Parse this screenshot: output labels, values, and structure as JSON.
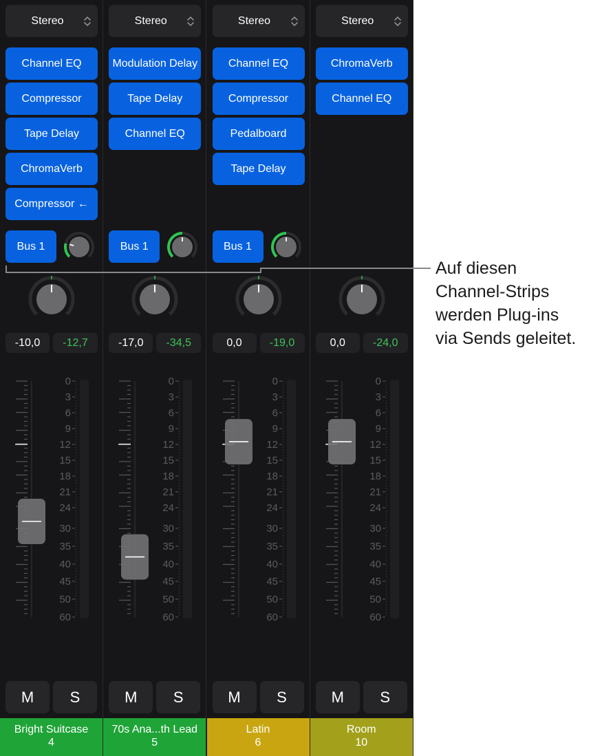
{
  "strips": [
    {
      "format": "Stereo",
      "plugins": [
        "Channel EQ",
        "Compressor",
        "Tape Delay",
        "ChromaVerb",
        "Compressor ←"
      ],
      "send": {
        "label": "Bus 1",
        "level": 0.22
      },
      "pan": 0,
      "volume": "-10,0",
      "meter_peak": "-12,7",
      "fader_db": -28,
      "mute": "M",
      "solo": "S",
      "name": "Bright Suitcase",
      "number": "4",
      "color": "#1fa437"
    },
    {
      "format": "Stereo",
      "plugins": [
        "Modulation Delay",
        "Tape Delay",
        "Channel EQ"
      ],
      "send": {
        "label": "Bus 1",
        "level": 0.5
      },
      "pan": 0,
      "volume": "-17,0",
      "meter_peak": "-34,5",
      "fader_db": -38,
      "mute": "M",
      "solo": "S",
      "name": "70s Ana...th Lead",
      "number": "5",
      "color": "#1fa437"
    },
    {
      "format": "Stereo",
      "plugins": [
        "Channel EQ",
        "Compressor",
        "Pedalboard",
        "Tape Delay"
      ],
      "send": {
        "label": "Bus 1",
        "level": 0.5
      },
      "pan": 0,
      "volume": "0,0",
      "meter_peak": "-19,0",
      "fader_db": -11.5,
      "mute": "M",
      "solo": "S",
      "name": "Latin",
      "number": "6",
      "color": "#c9a611"
    },
    {
      "format": "Stereo",
      "plugins": [
        "ChromaVerb",
        "Channel EQ"
      ],
      "send": null,
      "pan": 0,
      "volume": "0,0",
      "meter_peak": "-24,0",
      "fader_db": -11.5,
      "mute": "M",
      "solo": "S",
      "name": "Room",
      "number": "10",
      "color": "#a3a11b"
    }
  ],
  "scale_labels": [
    "0",
    "3",
    "6",
    "9",
    "12",
    "15",
    "18",
    "21",
    "24",
    "30",
    "35",
    "40",
    "45",
    "50",
    "60"
  ],
  "callout": {
    "lines": [
      "Auf diesen",
      "Channel-Strips",
      "werden Plug-ins",
      "via Sends geleitet."
    ]
  },
  "colors": {
    "plugin_blue": "#0862e0",
    "meter_green": "#3ec45a",
    "background": "#161618"
  }
}
